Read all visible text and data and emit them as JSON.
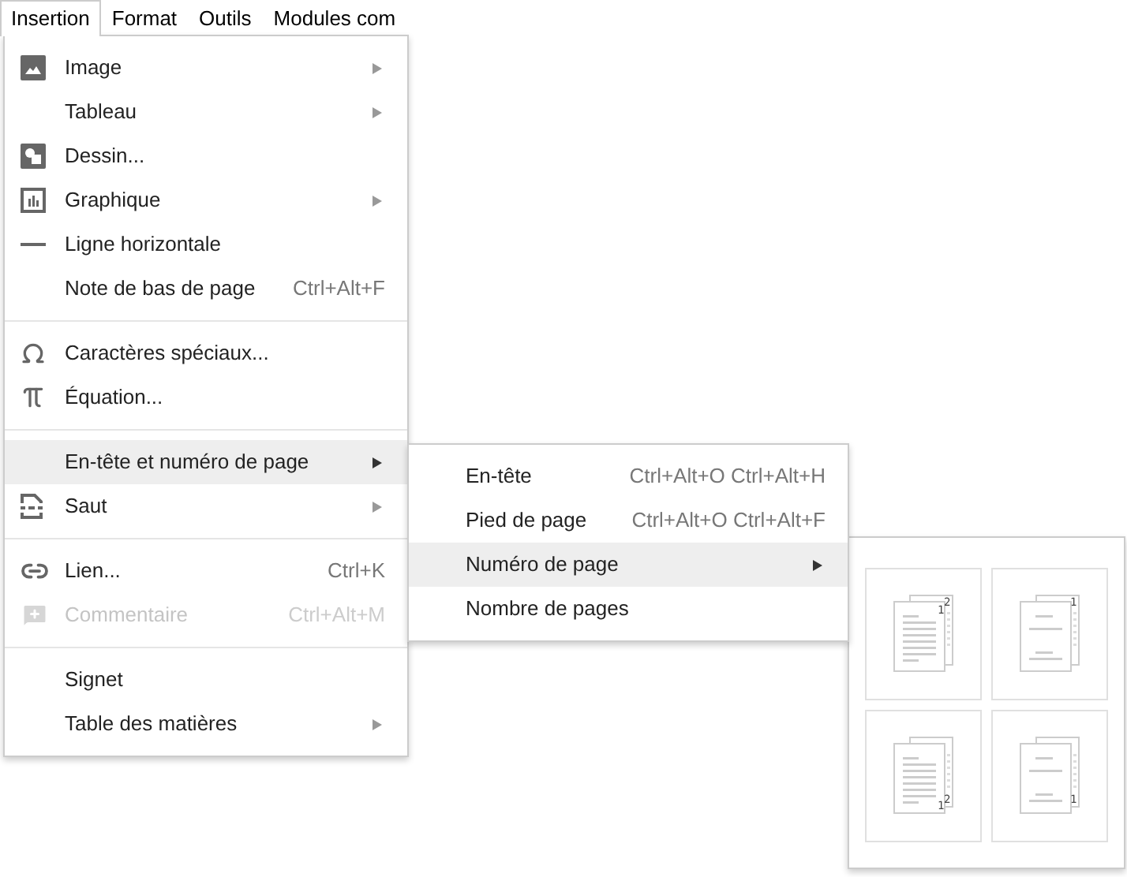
{
  "menubar": [
    {
      "label": "Insertion",
      "selected": true
    },
    {
      "label": "Format",
      "selected": false
    },
    {
      "label": "Outils",
      "selected": false
    },
    {
      "label": "Modules com",
      "selected": false
    }
  ],
  "menu": {
    "groups": [
      [
        {
          "label": "Image",
          "kind": "image",
          "submenu": true,
          "disabled": false,
          "selected": false
        },
        {
          "label": "Tableau",
          "submenu": true,
          "disabled": false,
          "selected": false
        },
        {
          "label": "Dessin...",
          "kind": "drawing",
          "submenu": false,
          "disabled": false,
          "selected": false
        },
        {
          "label": "Graphique",
          "kind": "chart",
          "submenu": true,
          "disabled": false,
          "selected": false
        },
        {
          "label": "Ligne horizontale",
          "kind": "line",
          "submenu": false,
          "disabled": false,
          "selected": false
        },
        {
          "label": "Note de bas de page",
          "shortcut": "Ctrl+Alt+F",
          "submenu": false,
          "disabled": false,
          "selected": false
        }
      ],
      [
        {
          "label": "Caractères spéciaux...",
          "kind": "omega",
          "submenu": false,
          "disabled": false,
          "selected": false
        },
        {
          "label": "Équation...",
          "kind": "pi",
          "submenu": false,
          "disabled": false,
          "selected": false
        }
      ],
      [
        {
          "label": "En-tête et numéro de page",
          "submenu": true,
          "disabled": false,
          "selected": true
        },
        {
          "label": "Saut",
          "kind": "break",
          "submenu": true,
          "disabled": false,
          "selected": false
        }
      ],
      [
        {
          "label": "Lien...",
          "kind": "link",
          "shortcut": "Ctrl+K",
          "submenu": false,
          "disabled": false,
          "selected": false
        },
        {
          "label": "Commentaire",
          "kind": "comment",
          "shortcut": "Ctrl+Alt+M",
          "submenu": false,
          "disabled": true,
          "selected": false
        }
      ],
      [
        {
          "label": "Signet",
          "submenu": false,
          "disabled": false,
          "selected": false
        },
        {
          "label": "Table des matières",
          "submenu": true,
          "disabled": false,
          "selected": false
        }
      ]
    ]
  },
  "submenu": [
    {
      "label": "En-tête",
      "shortcut": "Ctrl+Alt+O Ctrl+Alt+H",
      "submenu": false,
      "selected": false
    },
    {
      "label": "Pied de page",
      "shortcut": "Ctrl+Alt+O Ctrl+Alt+F",
      "submenu": false,
      "selected": false
    },
    {
      "label": "Numéro de page",
      "submenu": true,
      "selected": true
    },
    {
      "label": "Nombre de pages",
      "submenu": false,
      "selected": false
    }
  ],
  "page_number_options": [
    {
      "kind": "header",
      "front_number": "1",
      "back_number": "2"
    },
    {
      "kind": "header",
      "back_number": "1"
    },
    {
      "kind": "footer",
      "front_number": "1",
      "back_number": "2"
    },
    {
      "kind": "footer",
      "back_number": "1"
    }
  ]
}
